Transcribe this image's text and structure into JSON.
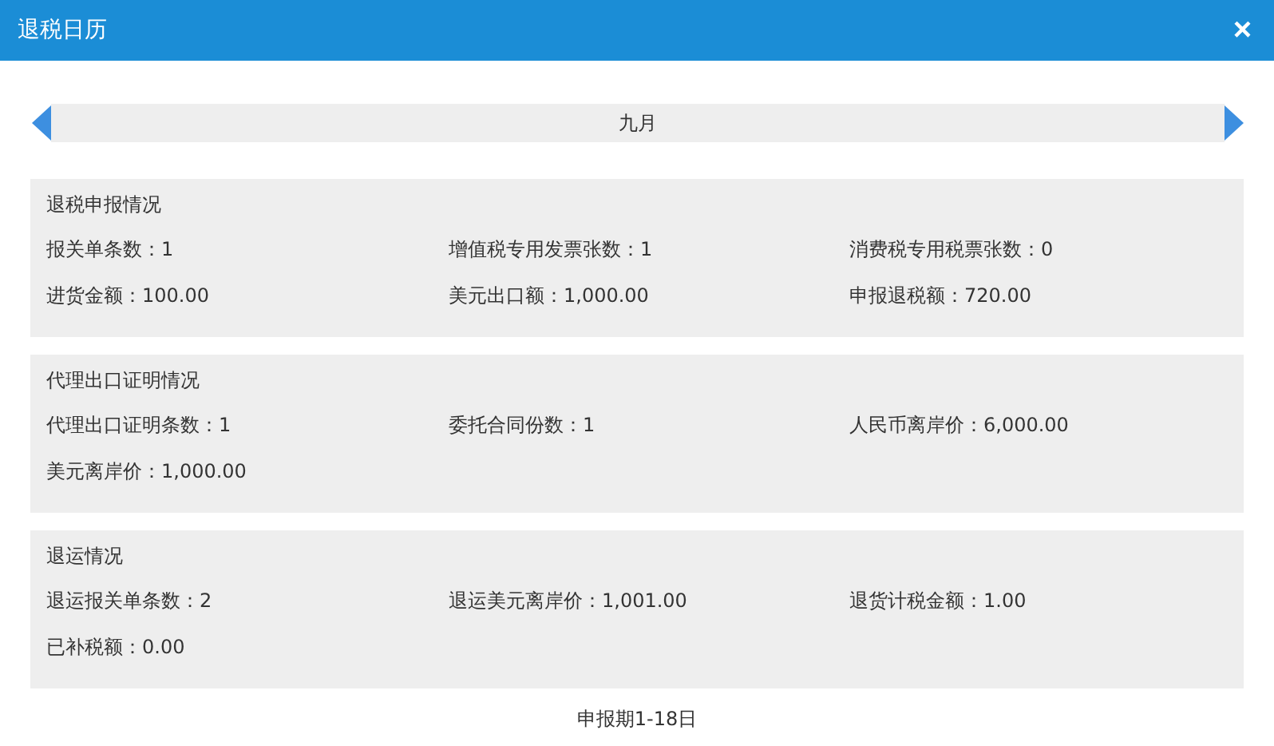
{
  "window": {
    "title": "退税日历",
    "close": "×"
  },
  "month_bar": {
    "label": "九月"
  },
  "sections": [
    {
      "title": "退税申报情况",
      "fields": [
        "报关单条数：1",
        "增值税专用发票张数：1",
        "消费税专用税票张数：0",
        "进货金额：100.00",
        "美元出口额：1,000.00",
        "申报退税额：720.00"
      ]
    },
    {
      "title": "代理出口证明情况",
      "fields": [
        "代理出口证明条数：1",
        "委托合同份数：1",
        "人民币离岸价：6,000.00",
        "美元离岸价：1,000.00"
      ]
    },
    {
      "title": "退运情况",
      "fields": [
        "退运报关单条数：2",
        "退运美元离岸价：1,001.00",
        "退货计税金额：1.00",
        "已补税额：0.00"
      ]
    }
  ],
  "footer": "申报期1-18日"
}
